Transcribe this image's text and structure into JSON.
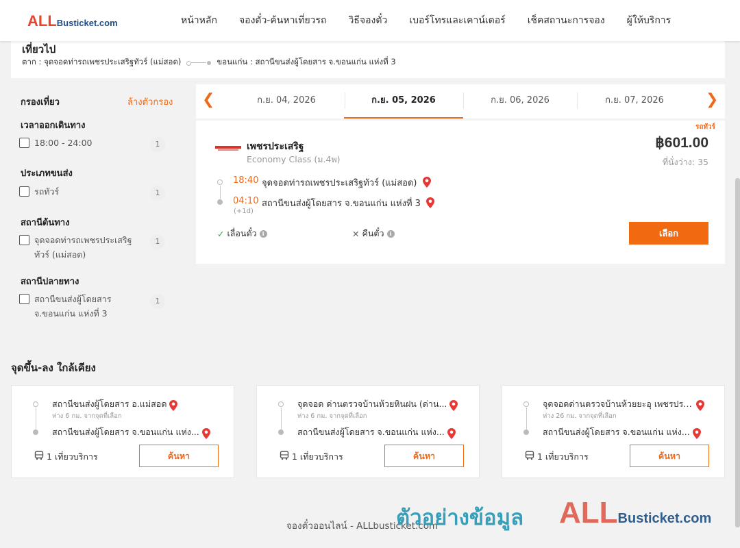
{
  "header": {
    "logo_all": "ALL",
    "logo_rest": "Busticket.com",
    "nav": [
      "หน้าหลัก",
      "จองตั๋ว-ค้นหาเที่ยวรถ",
      "วิธีจองตั๋ว",
      "เบอร์โทรและเคาน์เตอร์",
      "เช็คสถานะการจอง",
      "ผู้ให้บริการ"
    ]
  },
  "trip": {
    "title": "เที่ยวไป",
    "from": "ตาก : จุดจอดท่ารถเพชรประเสริฐทัวร์ (แม่สอด)",
    "to": "ขอนแก่น : สถานีขนส่งผู้โดยสาร จ.ขอนแก่น แห่งที่ 3"
  },
  "filters": {
    "heading": "กรองเที่ยว",
    "clear": "ล้างตัวกรอง",
    "groups": [
      {
        "title": "เวลาออกเดินทาง",
        "option": "18:00 - 24:00",
        "count": "1"
      },
      {
        "title": "ประเภทขนส่ง",
        "option": "รถทัวร์",
        "count": "1"
      },
      {
        "title": "สถานีต้นทาง",
        "option": "จุดจอดท่ารถเพชรประเสริฐทัวร์ (แม่สอด)",
        "count": "1"
      },
      {
        "title": "สถานีปลายทาง",
        "option": "สถานีขนส่งผู้โดยสาร จ.ขอนแก่น แห่งที่ 3",
        "count": "1"
      }
    ]
  },
  "dates": {
    "tabs": [
      "ก.ย. 04, 2026",
      "ก.ย. 05, 2026",
      "ก.ย. 06, 2026",
      "ก.ย. 07, 2026"
    ],
    "active_index": 1,
    "prev_icon": "chevron-left-icon",
    "next_icon": "chevron-right-icon"
  },
  "result": {
    "tag": "รถทัวร์",
    "operator": "เพชรประเสริฐ",
    "class": "Economy Class (ม.4พ)",
    "price": "฿601.00",
    "seats": "ที่นั่งว่าง: 35",
    "depart_time": "18:40",
    "depart_stop": "จุดจอดท่ารถเพชรประเสริฐทัวร์ (แม่สอด)",
    "arrive_time": "04:10",
    "arrive_stop": "สถานีขนส่งผู้โดยสาร จ.ขอนแก่น แห่งที่ 3",
    "plus_day": "(+1d)",
    "change_policy": "เลื่อนตั๋ว",
    "refund_policy": "คืนตั๋ว",
    "select_label": "เลือก"
  },
  "nearby": {
    "title": "จุดขึ้น-ลง ใกล้เคียง",
    "cards": [
      {
        "from": "สถานีขนส่งผู้โดยสาร อ.แม่สอด",
        "distance": "ห่าง 6 กม. จากจุดที่เลือก",
        "to": "สถานีขนส่งผู้โดยสาร จ.ขอนแก่น แห่ง...",
        "trips": "1 เที่ยวบริการ",
        "button": "ค้นหา"
      },
      {
        "from": "จุดจอด ด่านตรวจบ้านห้วยหินฝน (ด่าน...",
        "distance": "ห่าง 6 กม. จากจุดที่เลือก",
        "to": "สถานีขนส่งผู้โดยสาร จ.ขอนแก่น แห่ง...",
        "trips": "1 เที่ยวบริการ",
        "button": "ค้นหา"
      },
      {
        "from": "จุดจอดด่านตรวจบ้านห้วยยะอุ เพชรประ...",
        "distance": "ห่าง 26 กม. จากจุดที่เลือก",
        "to": "สถานีขนส่งผู้โดยสาร จ.ขอนแก่น แห่ง...",
        "trips": "1 เที่ยวบริการ",
        "button": "ค้นหา"
      }
    ]
  },
  "footer": {
    "text": "จองตั๋วออนไลน์ - ALLbusticket.com"
  },
  "watermark": {
    "thai": "ตัวอย่างข้อมูล",
    "all": "ALL",
    "rest": "Busticket.com"
  },
  "colors": {
    "accent": "#f26a10",
    "pin": "#e53935"
  }
}
